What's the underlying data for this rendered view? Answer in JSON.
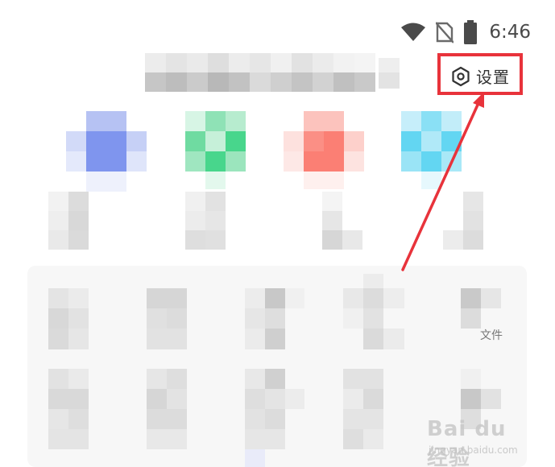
{
  "status_bar": {
    "time": "6:46",
    "icons": [
      "wifi-icon",
      "no-sim-icon",
      "battery-icon"
    ]
  },
  "header": {
    "settings_label": "设置",
    "settings_icon": "gear-icon"
  },
  "colors": {
    "highlight": "#e8333b",
    "blue": "#7f95ee",
    "green": "#48d68c",
    "red": "#fb7f74",
    "cyan": "#63d6f2"
  },
  "partial_text": "文件",
  "watermark": {
    "brand": "Bai du 经验",
    "sub": "jingyan.baidu.com"
  }
}
